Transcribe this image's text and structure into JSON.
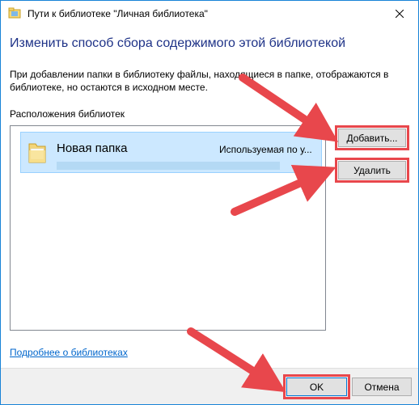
{
  "window": {
    "title": "Пути к библиотеке \"Личная библиотека\"",
    "close_icon": "close-icon"
  },
  "dialog": {
    "heading": "Изменить способ сбора содержимого этой библиотекой",
    "description": "При добавлении папки в библиотеку файлы, находящиеся в папке, отображаются в библиотеке, но остаются в исходном месте.",
    "locations_label": "Расположения библиотек"
  },
  "locations": [
    {
      "name": "Новая папка",
      "status": "Используемая по у...",
      "icon": "folder-icon"
    }
  ],
  "buttons": {
    "add": "Добавить...",
    "remove": "Удалить",
    "ok": "OK",
    "cancel": "Отмена"
  },
  "links": {
    "help": "Подробнее о библиотеках"
  },
  "colors": {
    "accent": "#1883d7",
    "heading": "#1e3287",
    "selection": "#cce8ff",
    "annotation": "#e8474c"
  }
}
